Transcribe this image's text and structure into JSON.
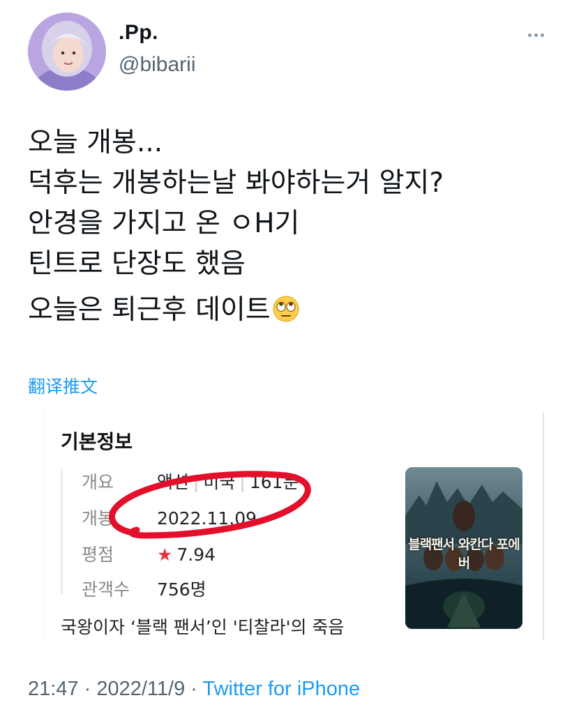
{
  "user": {
    "display_name": ".Pp.",
    "handle": "@bibarii",
    "avatar_icon": "profile-photo"
  },
  "tweet": {
    "lines": [
      "오늘 개봉...",
      "덕후는 개봉하는날 봐야하는거 알지?",
      "안경을 가지고 온 ㅇH기",
      "틴트로 단장도 했음"
    ],
    "last_line": "오늘은 퇴근후 데이트",
    "emoji": "rolling-eyes-emoji",
    "translate_label": "翻译推文"
  },
  "card": {
    "title": "기본정보",
    "rows": [
      {
        "key": "개요",
        "value_parts": [
          "액션",
          "미국",
          "161분"
        ]
      },
      {
        "key": "개봉",
        "value": "2022.11.09."
      },
      {
        "key": "평점",
        "star": "★",
        "value": "7.94"
      },
      {
        "key": "관객수",
        "value": "756명"
      }
    ],
    "synopsis": "국왕이자 ‘블랙 팬서’인 '티찰라'의 죽음",
    "poster_title": "블랙팬서 와칸다 포에버"
  },
  "footer": {
    "time": "21:47",
    "date": "2022/11/9",
    "source": "Twitter for iPhone"
  },
  "colors": {
    "accent": "#1d9bf0",
    "secondary_text": "#536471",
    "highlight_circle": "#e2102a",
    "star": "#e8303f"
  }
}
